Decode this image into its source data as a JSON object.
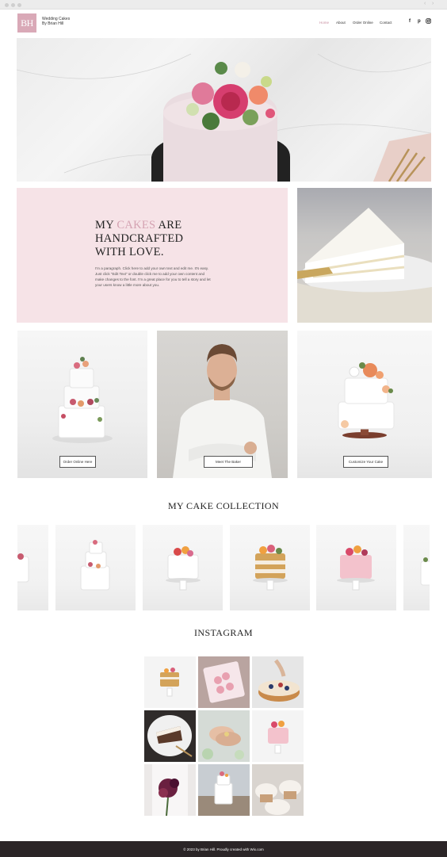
{
  "header": {
    "logo_text": "BH",
    "site_title_line1": "Wedding Cakes",
    "site_title_line2": "By Brian Hill",
    "nav": [
      "Home",
      "About",
      "Order Online",
      "Contact"
    ],
    "active_nav": "Home",
    "social_icons": [
      "facebook-icon",
      "pinterest-icon",
      "instagram-icon"
    ]
  },
  "intro": {
    "heading_part1": "MY ",
    "heading_accent": "CAKES",
    "heading_part2": " ARE",
    "heading_line2": "HANDCRAFTED",
    "heading_line3": "WITH LOVE.",
    "body": "I'm a paragraph. Click here to add your own text and edit me. It's easy. Just click “Edit Text” or double click me to add your own content and make changes to the font. I'm a great place for you to tell a story and let your users know a little more about you."
  },
  "cards": {
    "order_label": "Order Online Here",
    "baker_label": "Meet The Baker",
    "customize_label": "Customize Your Cake"
  },
  "collection": {
    "title": "MY CAKE COLLECTION"
  },
  "instagram": {
    "title": "INSTAGRAM"
  },
  "footer": {
    "text": "© 2023 by Brian Hill. Proudly created with Wix.com"
  },
  "colors": {
    "accent_pink": "#d9a9b7",
    "panel_pink": "#f6e3e7",
    "footer_bg": "#2b2527"
  }
}
